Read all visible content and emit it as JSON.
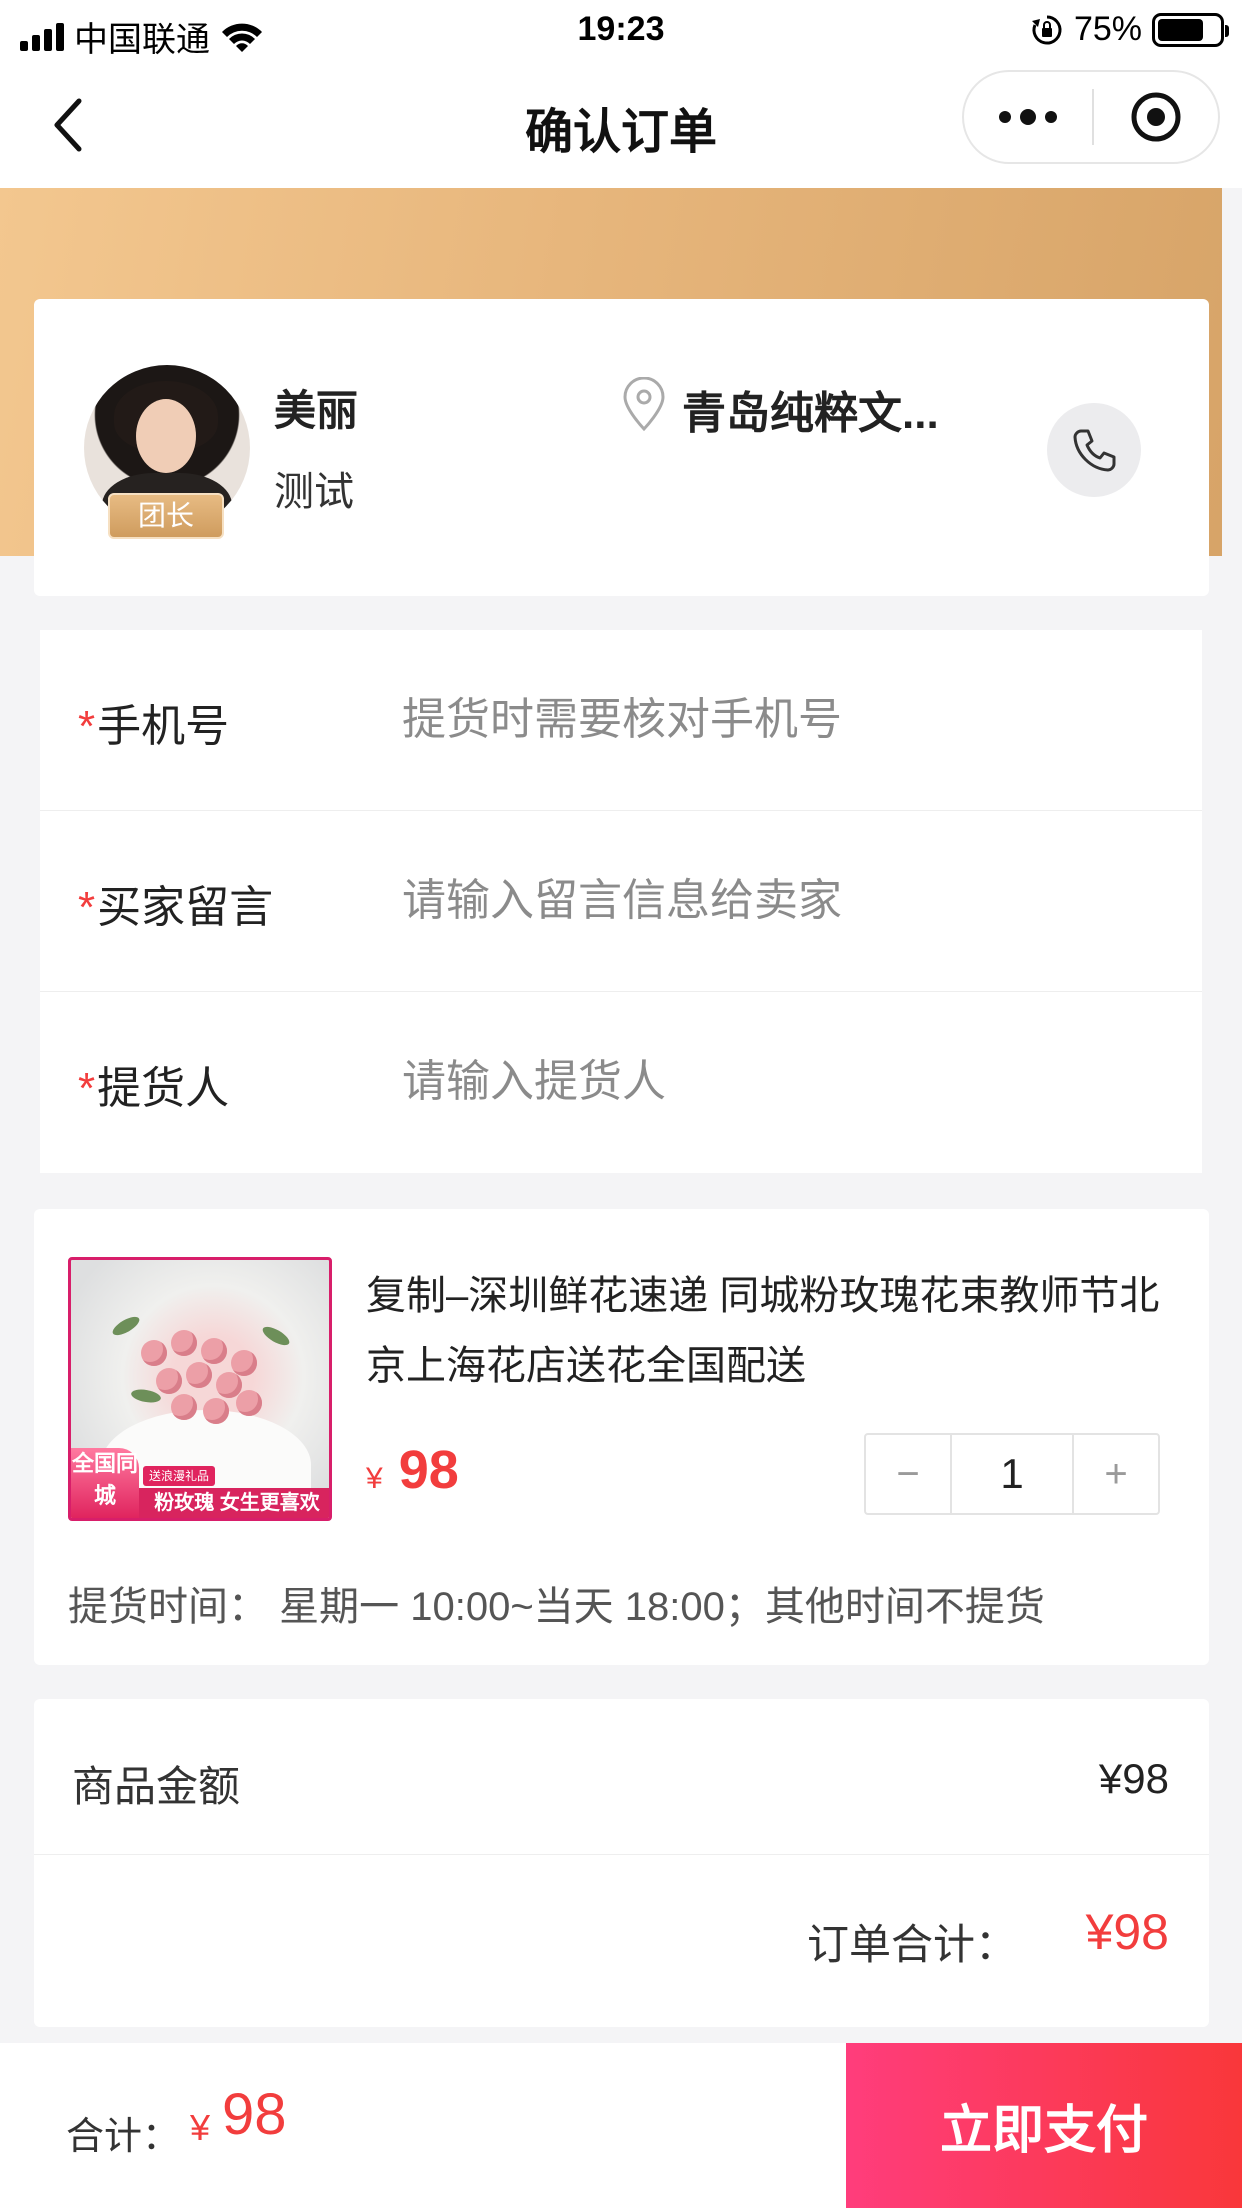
{
  "status_bar": {
    "carrier": "中国联通",
    "time": "19:23",
    "battery": "75%",
    "battery_level": 0.75
  },
  "nav": {
    "title": "确认订单"
  },
  "leader": {
    "name": "美丽",
    "subtitle": "测试",
    "badge": "团长",
    "location": "青岛纯粹文..."
  },
  "form": {
    "fields": [
      {
        "required_mark": "*",
        "label": "手机号",
        "placeholder": "提货时需要核对手机号",
        "value": ""
      },
      {
        "required_mark": "*",
        "label": "买家留言",
        "placeholder": "请输入留言信息给卖家",
        "value": ""
      },
      {
        "required_mark": "*",
        "label": "提货人",
        "placeholder": "请输入提货人",
        "value": ""
      }
    ]
  },
  "product": {
    "title": "复制–深圳鲜花速递 同城粉玫瑰花束教师节北京上海花店送花全国配送",
    "currency": "¥",
    "price": "98",
    "quantity": "1",
    "minus": "−",
    "plus": "+",
    "pickup_time": "提货时间：  星期一 10:00~当天 18:00；其他时间不提货",
    "image_tags": {
      "left": "全国同城",
      "bottom": "粉玫瑰 女生更喜欢",
      "mini": "送浪漫礼品"
    }
  },
  "summary": {
    "goods_label": "商品金额",
    "goods_value": "¥98",
    "total_label": "订单合计：",
    "total_value": "¥98"
  },
  "bottom_bar": {
    "total_label": "合计：",
    "currency": "¥",
    "total_value": "98",
    "pay_button": "立即支付"
  },
  "colors": {
    "accent_red": "#f23d3d",
    "gold_start": "#f3c78f",
    "gold_end": "#d7a468",
    "pay_start": "#ff3d7c",
    "pay_end": "#f9373a"
  }
}
